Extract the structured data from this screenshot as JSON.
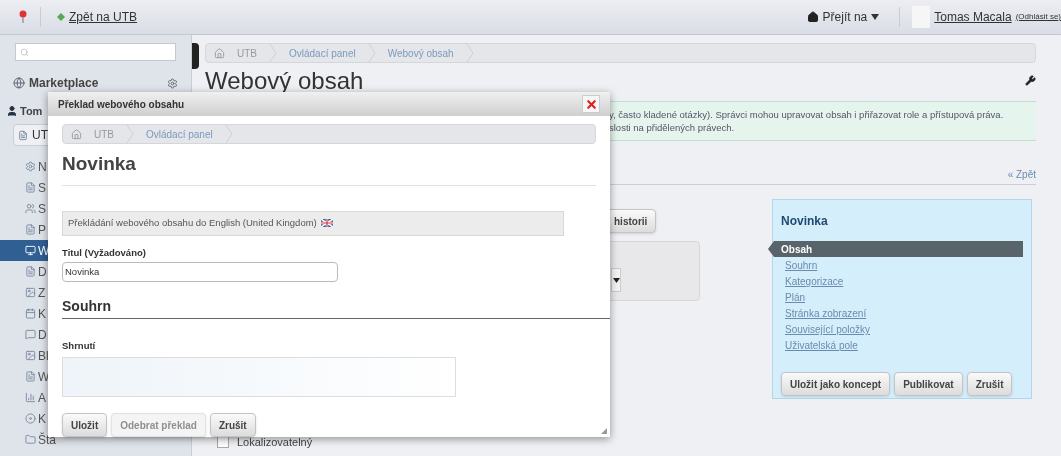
{
  "top_bar": {
    "back_link": "Zpět na UTB",
    "goto_menu": "Přejít na",
    "user_name": "Tomas Macala",
    "logout": "(Odhlásit se)"
  },
  "sidebar": {
    "marketplace": "Marketplace",
    "user_site": "Tom",
    "site_button": "UT",
    "items": [
      {
        "label": "N",
        "kind": "gear",
        "selected": false
      },
      {
        "label": "S",
        "kind": "page",
        "selected": false
      },
      {
        "label": "S",
        "kind": "users",
        "selected": false
      },
      {
        "label": "P",
        "kind": "page",
        "selected": false
      },
      {
        "label": "W",
        "kind": "monitor",
        "selected": true
      },
      {
        "label": "D",
        "kind": "page",
        "selected": false
      },
      {
        "label": "Z",
        "kind": "image",
        "selected": false
      },
      {
        "label": "K",
        "kind": "calendar",
        "selected": false
      },
      {
        "label": "D",
        "kind": "chat",
        "selected": false
      },
      {
        "label": "Bl",
        "kind": "image",
        "selected": false
      },
      {
        "label": "W",
        "kind": "page",
        "selected": false
      },
      {
        "label": "A",
        "kind": "chart",
        "selected": false
      },
      {
        "label": "K",
        "kind": "disc",
        "selected": false
      },
      {
        "label": "Šta",
        "kind": "folder",
        "selected": false
      }
    ]
  },
  "breadcrumb": [
    "UTB",
    "Ovládací panel",
    "Webový obsah"
  ],
  "page_title": "Webový obsah",
  "info_lines": [
    "y, často kladené otázky). Správci mohou upravovat obsah i přiřazovat role a přístupová práva.",
    "slosti na přidělených právech."
  ],
  "back_link": "« Zpět",
  "history_button": "historii",
  "localizable": {
    "label": "Lokalizovatelný",
    "checked": false
  },
  "side_panel": {
    "title": "Novinka",
    "nav": [
      {
        "label": "Obsah",
        "selected": true
      },
      {
        "label": "Souhrn",
        "selected": false
      },
      {
        "label": "Kategorizace",
        "selected": false
      },
      {
        "label": "Plán",
        "selected": false
      },
      {
        "label": "Stránka zobrazení",
        "selected": false
      },
      {
        "label": "Související položky",
        "selected": false
      },
      {
        "label": "Uživatelská pole",
        "selected": false
      }
    ],
    "buttons": [
      "Uložit jako koncept",
      "Publikovat",
      "Zrušit"
    ]
  },
  "dialog": {
    "title": "Překlad webového obsahu",
    "breadcrumb": [
      "UTB",
      "Ovládací panel"
    ],
    "heading": "Novinka",
    "notice": "Překládání webového obsahu do English (United Kingdom)",
    "title_field": {
      "label": "Titul (Vyžadováno)",
      "value": "Novinka"
    },
    "section": "Souhrn",
    "summary_label": "Shrnutí",
    "buttons": [
      {
        "label": "Uložit",
        "disabled": false
      },
      {
        "label": "Odebrat překlad",
        "disabled": true
      },
      {
        "label": "Zrušit",
        "disabled": false
      }
    ]
  }
}
